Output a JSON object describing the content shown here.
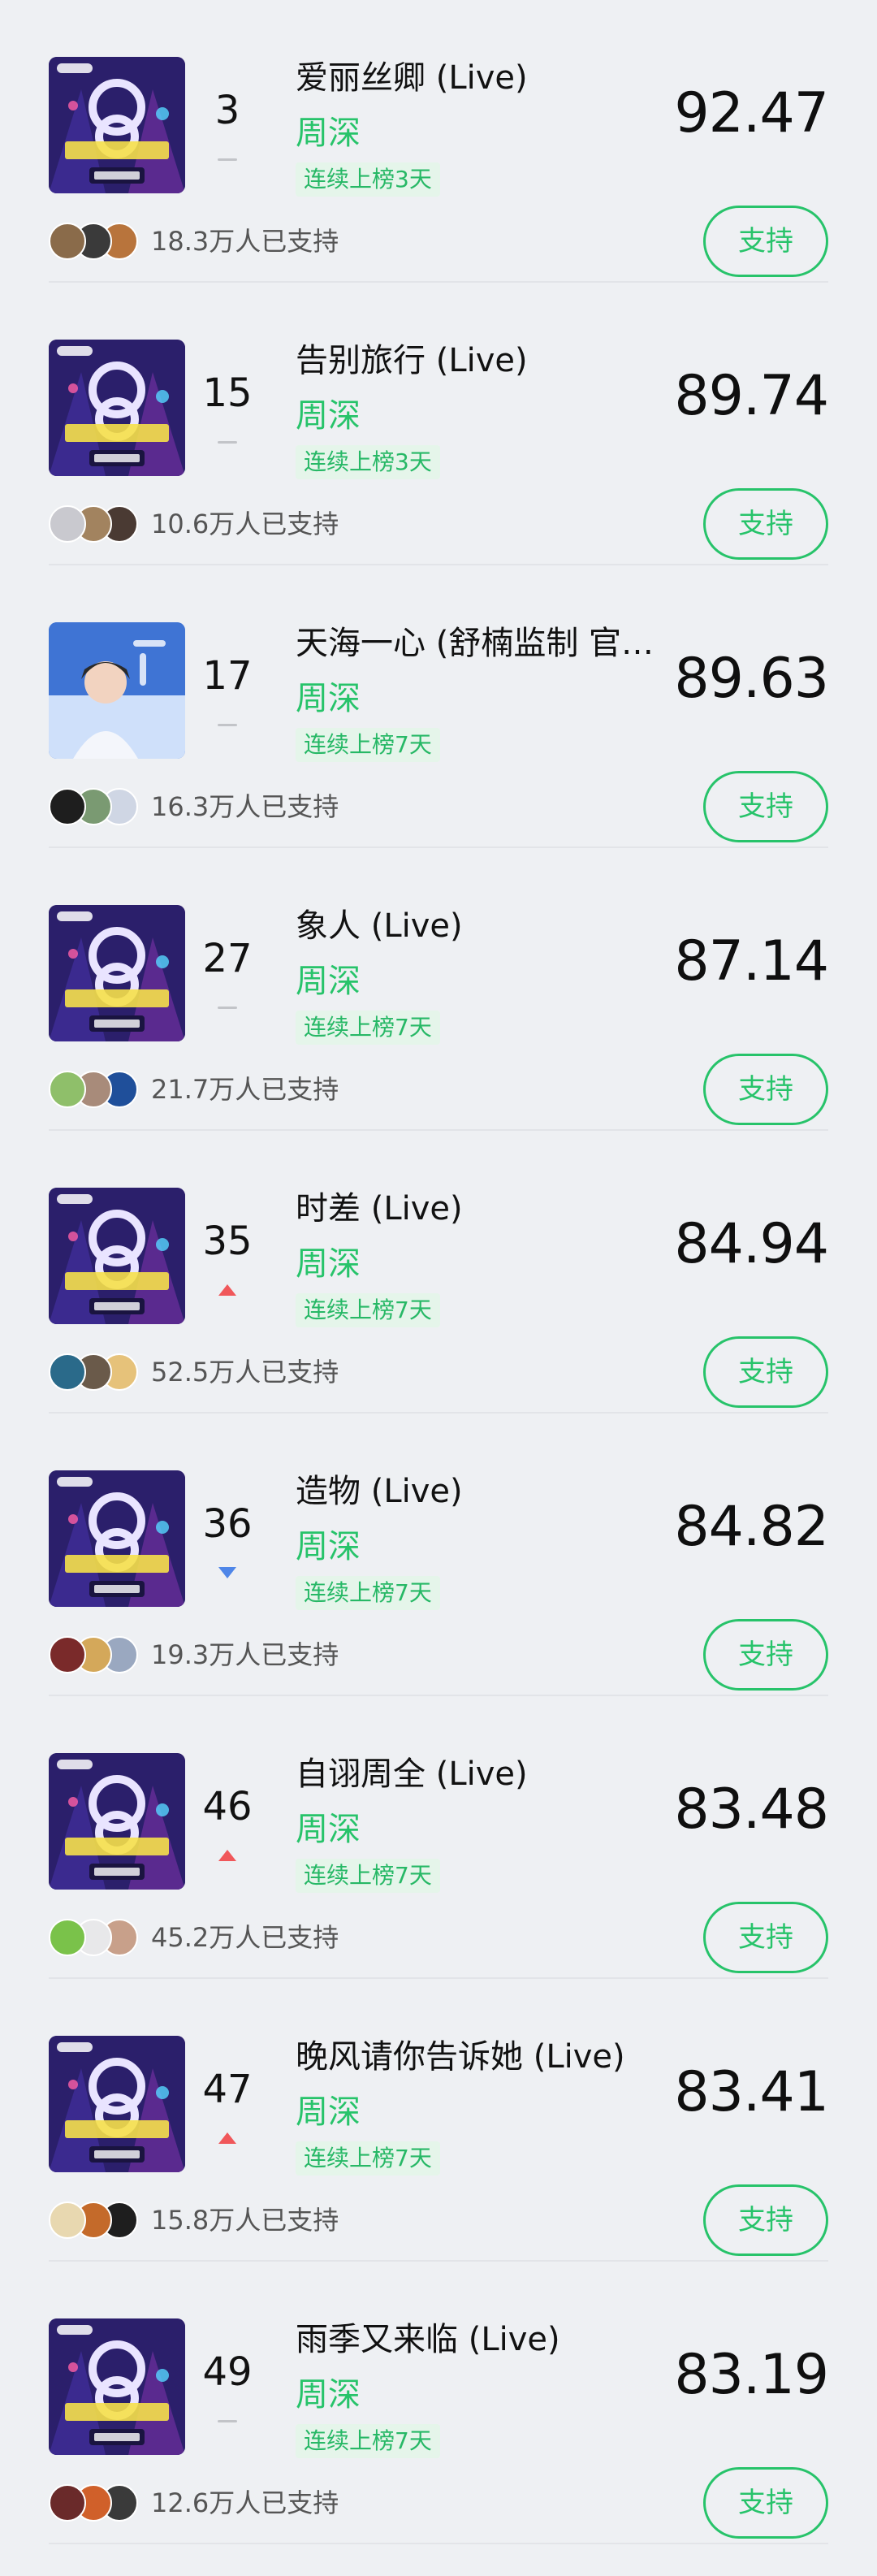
{
  "songs": [
    {
      "rank": "3",
      "trend": "same",
      "title": "爱丽丝卿 (Live)",
      "artist": "周深",
      "streak": "连续上榜3天",
      "score": "92.47",
      "supporters": "18.3万人已支持",
      "support_label": "支持",
      "cover": "stage",
      "avatar_colors": [
        "#8a6b4a",
        "#3a3a3a",
        "#b8743c"
      ]
    },
    {
      "rank": "15",
      "trend": "same",
      "title": "告别旅行 (Live)",
      "artist": "周深",
      "streak": "连续上榜3天",
      "score": "89.74",
      "supporters": "10.6万人已支持",
      "support_label": "支持",
      "cover": "stage",
      "avatar_colors": [
        "#c9c9cf",
        "#a2835f",
        "#4a3a33"
      ]
    },
    {
      "rank": "17",
      "trend": "same",
      "title": "天海一心 (舒楠监制 官方正式版)",
      "artist": "周深",
      "streak": "连续上榜7天",
      "score": "89.63",
      "supporters": "16.3万人已支持",
      "support_label": "支持",
      "cover": "portrait",
      "avatar_colors": [
        "#1e1e1e",
        "#7a9a72",
        "#cfd6e4"
      ]
    },
    {
      "rank": "27",
      "trend": "same",
      "title": "象人 (Live)",
      "artist": "周深",
      "streak": "连续上榜7天",
      "score": "87.14",
      "supporters": "21.7万人已支持",
      "support_label": "支持",
      "cover": "stage",
      "avatar_colors": [
        "#8fbf6a",
        "#a88b7a",
        "#1f4f9a"
      ]
    },
    {
      "rank": "35",
      "trend": "up",
      "title": "时差 (Live)",
      "artist": "周深",
      "streak": "连续上榜7天",
      "score": "84.94",
      "supporters": "52.5万人已支持",
      "support_label": "支持",
      "cover": "stage",
      "avatar_colors": [
        "#2a6a8a",
        "#6a5a4a",
        "#e6c27a"
      ]
    },
    {
      "rank": "36",
      "trend": "down",
      "title": "造物 (Live)",
      "artist": "周深",
      "streak": "连续上榜7天",
      "score": "84.82",
      "supporters": "19.3万人已支持",
      "support_label": "支持",
      "cover": "stage",
      "avatar_colors": [
        "#7a2a2a",
        "#d4a85a",
        "#9aa8c0"
      ]
    },
    {
      "rank": "46",
      "trend": "up",
      "title": "自诩周全 (Live)",
      "artist": "周深",
      "streak": "连续上榜7天",
      "score": "83.48",
      "supporters": "45.2万人已支持",
      "support_label": "支持",
      "cover": "stage",
      "avatar_colors": [
        "#7ac24a",
        "#e8e8ea",
        "#c8a08a"
      ]
    },
    {
      "rank": "47",
      "trend": "up",
      "title": "晚风请你告诉她 (Live)",
      "artist": "周深",
      "streak": "连续上榜7天",
      "score": "83.41",
      "supporters": "15.8万人已支持",
      "support_label": "支持",
      "cover": "stage",
      "avatar_colors": [
        "#e8d8b0",
        "#c46a2a",
        "#1e1e1e"
      ]
    },
    {
      "rank": "49",
      "trend": "same",
      "title": "雨季又来临 (Live)",
      "artist": "周深",
      "streak": "连续上榜7天",
      "score": "83.19",
      "supporters": "12.6万人已支持",
      "support_label": "支持",
      "cover": "stage",
      "avatar_colors": [
        "#6a2a2a",
        "#d0602a",
        "#3a3a3a"
      ]
    }
  ],
  "colors": {
    "accent": "#27c36a",
    "trend_up": "#f0575a",
    "trend_down": "#4f86e8",
    "trend_same": "#c2c4c8",
    "background": "#eef0f3"
  }
}
